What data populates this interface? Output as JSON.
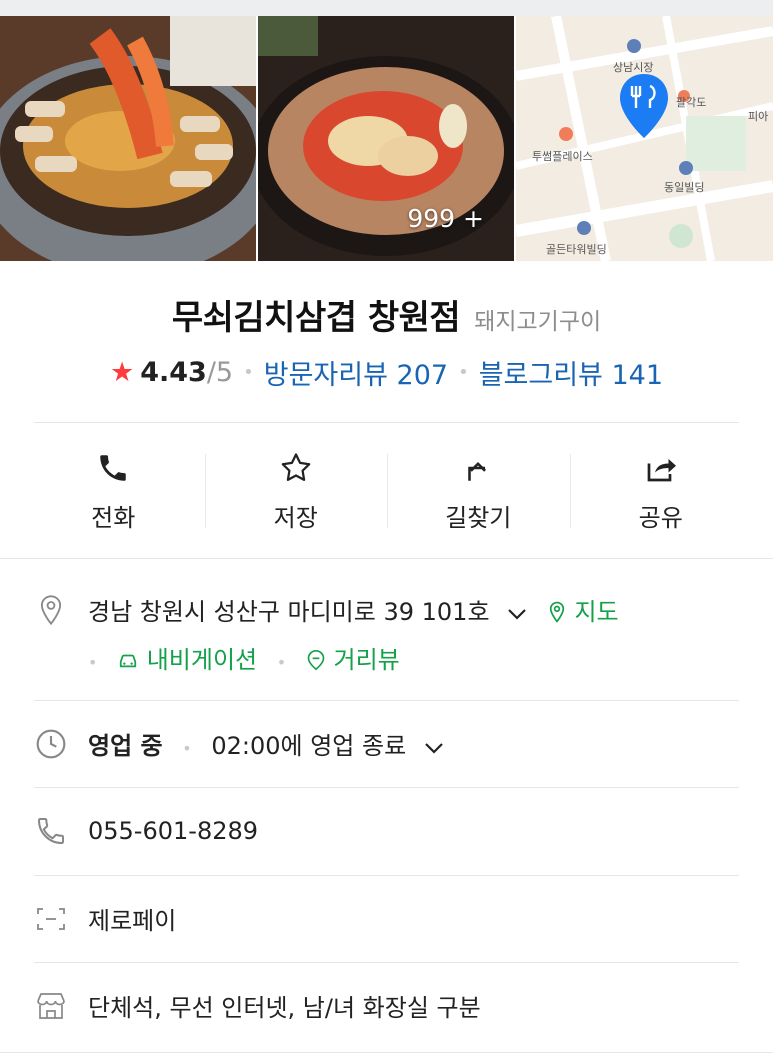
{
  "gallery": {
    "photo_count": "999 +",
    "map_labels": {
      "market": "상남시장",
      "palgakdo": "팔각도",
      "pia": "피아",
      "tussem": "투썸플레이스",
      "dongil": "동일빌딩",
      "golden": "골든타워빌딩"
    }
  },
  "place": {
    "name": "무쇠김치삼겹 창원점",
    "category": "돼지고기구이",
    "rating": "4.43",
    "rating_max": "/5",
    "visitor_reviews": "방문자리뷰 207",
    "blog_reviews": "블로그리뷰 141"
  },
  "actions": [
    {
      "label": "전화",
      "icon": "phone-icon"
    },
    {
      "label": "저장",
      "icon": "star-outline-icon"
    },
    {
      "label": "길찾기",
      "icon": "directions-icon"
    },
    {
      "label": "공유",
      "icon": "share-icon"
    }
  ],
  "info": {
    "address": "경남 창원시 성산구 마디미로 39 101호",
    "map_link": "지도",
    "navigation_link": "내비게이션",
    "streetview_link": "거리뷰",
    "hours_status": "영업 중",
    "hours_detail": "02:00에 영업 종료",
    "phone": "055-601-8289",
    "payment": "제로페이",
    "amenities": "단체석, 무선 인터넷, 남/녀 화장실 구분"
  },
  "colors": {
    "rating_star": "#ff3b3b",
    "link_blue": "#1a64b4",
    "link_green": "#14a14a",
    "map_pin": "#1b7cf3"
  }
}
